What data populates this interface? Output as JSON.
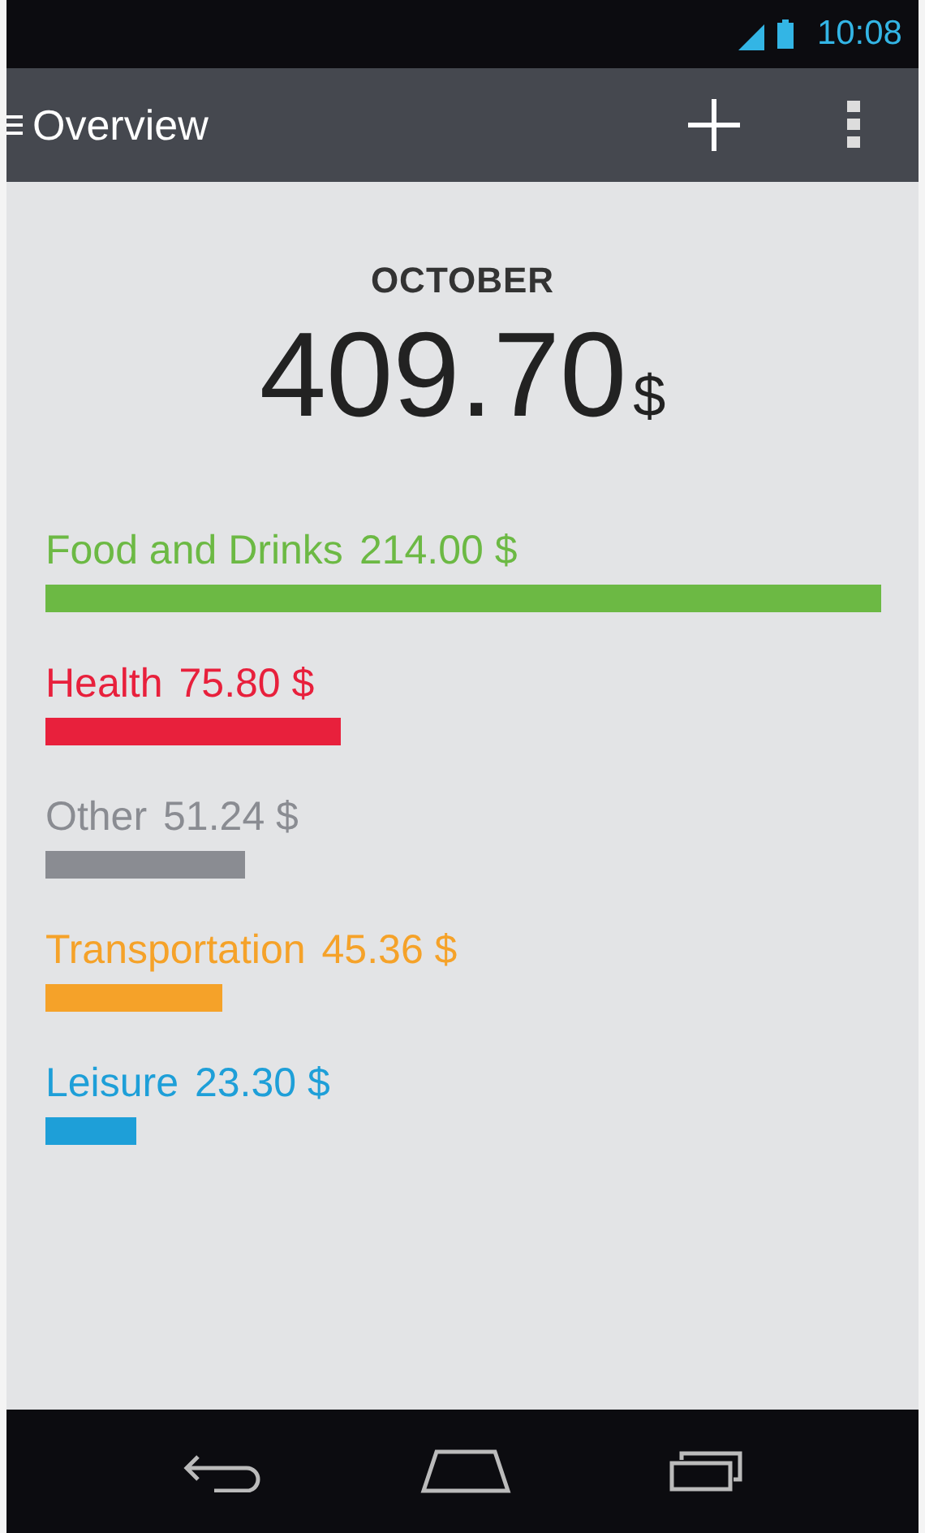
{
  "status_bar": {
    "time": "10:08"
  },
  "action_bar": {
    "title": "Overview"
  },
  "summary": {
    "month": "OCTOBER",
    "total": "409.70",
    "currency": "$"
  },
  "categories": [
    {
      "name": "Food and Drinks",
      "amount": "214.00 $",
      "color": "#6cb944"
    },
    {
      "name": "Health",
      "amount": "75.80 $",
      "color": "#e8203c"
    },
    {
      "name": "Other",
      "amount": "51.24 $",
      "color": "#8a8c92"
    },
    {
      "name": "Transportation",
      "amount": "45.36 $",
      "color": "#f5a229"
    },
    {
      "name": "Leisure",
      "amount": "23.30 $",
      "color": "#1e9fd8"
    }
  ]
}
